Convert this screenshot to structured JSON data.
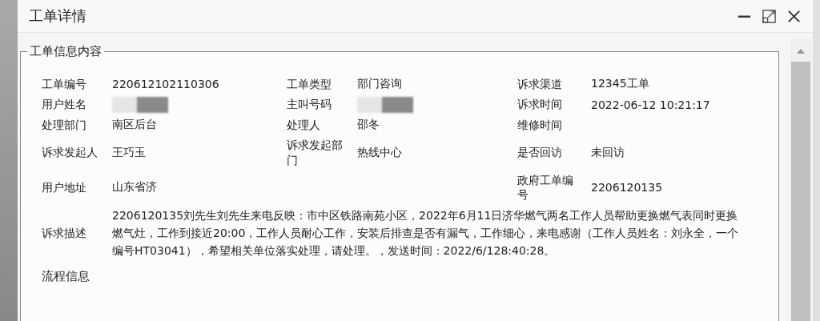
{
  "window": {
    "title": "工单详情"
  },
  "section": {
    "legend": "工单信息内容"
  },
  "rows": [
    {
      "cells": [
        {
          "label": "工单编号",
          "value": "220612102110306"
        },
        {
          "label": "工单类型",
          "value": "部门咨询"
        },
        {
          "label": "诉求渠道",
          "value": "12345工单"
        }
      ]
    },
    {
      "cells": [
        {
          "label": "用户姓名",
          "redacted": true
        },
        {
          "label": "主叫号码",
          "redacted": true
        },
        {
          "label": "诉求时间",
          "value": "2022-06-12 10:21:17"
        }
      ]
    },
    {
      "cells": [
        {
          "label": "处理部门",
          "value": "南区后台"
        },
        {
          "label": "处理人",
          "value": "邵冬"
        },
        {
          "label": "维修时间"
        }
      ]
    },
    {
      "cells": [
        {
          "label": "诉求发起人",
          "value": "王巧玉"
        },
        {
          "label": "诉求发起部门",
          "value": "热线中心"
        },
        {
          "label": "是否回访",
          "value": "未回访"
        }
      ]
    },
    {
      "cells": [
        {
          "label": "用户地址",
          "value": "山东省济"
        },
        {},
        {
          "label": "政府工单编号",
          "value": "2206120135"
        }
      ]
    }
  ],
  "description": {
    "label": "诉求描述",
    "value": "2206120135刘先生刘先生来电反映：市中区铁路南苑小区，2022年6月11日济华燃气两名工作人员帮助更换燃气表同时更换燃气灶，工作到接近20:00，工作人员耐心工作，安装后排查是否有漏气，工作细心，来电感谢（工作人员姓名：刘永全，一个编号HT03041），希望相关单位落实处理，请处理。，发送时间：2022/6/128:40:28。"
  },
  "next_section": "流程信息"
}
